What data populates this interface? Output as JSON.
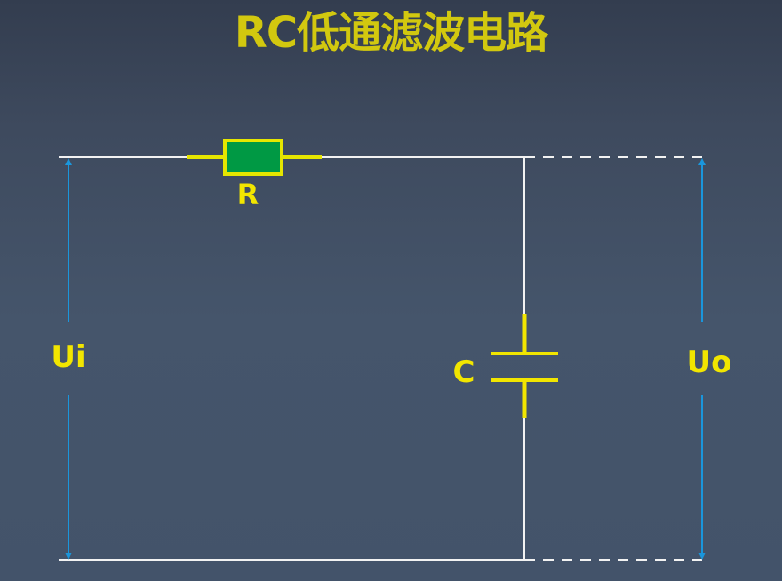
{
  "title": "RC低通滤波电路",
  "labels": {
    "resistor": "R",
    "capacitor": "C",
    "input_voltage": "Ui",
    "output_voltage": "Uo"
  },
  "colors": {
    "title": "#d2c80f",
    "label": "#f2e600",
    "wire": "#f2f2f2",
    "arrow": "#1a96dc",
    "resistor_fill": "#009944",
    "resistor_border": "#e6e600",
    "capacitor": "#f2e600",
    "resistor_lead": "#e6e600"
  }
}
